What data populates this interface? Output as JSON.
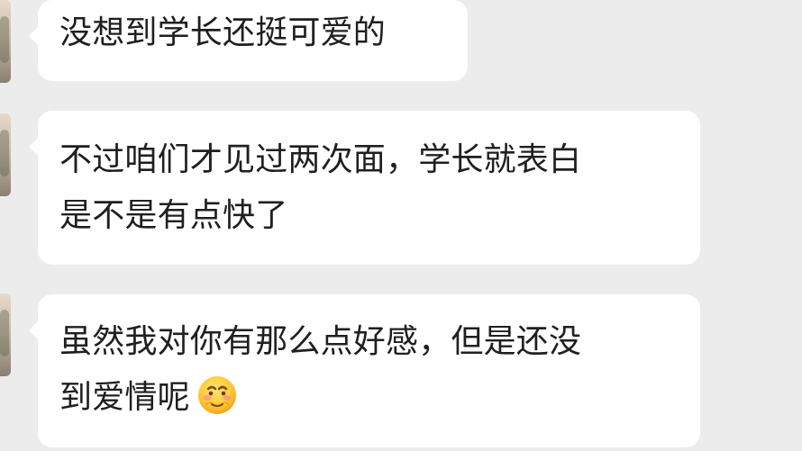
{
  "messages": [
    {
      "lines": [
        "没想到学长还挺可爱的"
      ]
    },
    {
      "lines": [
        "不过咱们才见过两次面，学长就表白",
        "是不是有点快了"
      ]
    },
    {
      "lines": [
        "虽然我对你有那么点好感，但是还没",
        "到爱情呢"
      ],
      "emoji": "shy-face-icon"
    }
  ],
  "colors": {
    "background": "#ececec",
    "bubble": "#ffffff",
    "text": "#1f1f1f"
  }
}
